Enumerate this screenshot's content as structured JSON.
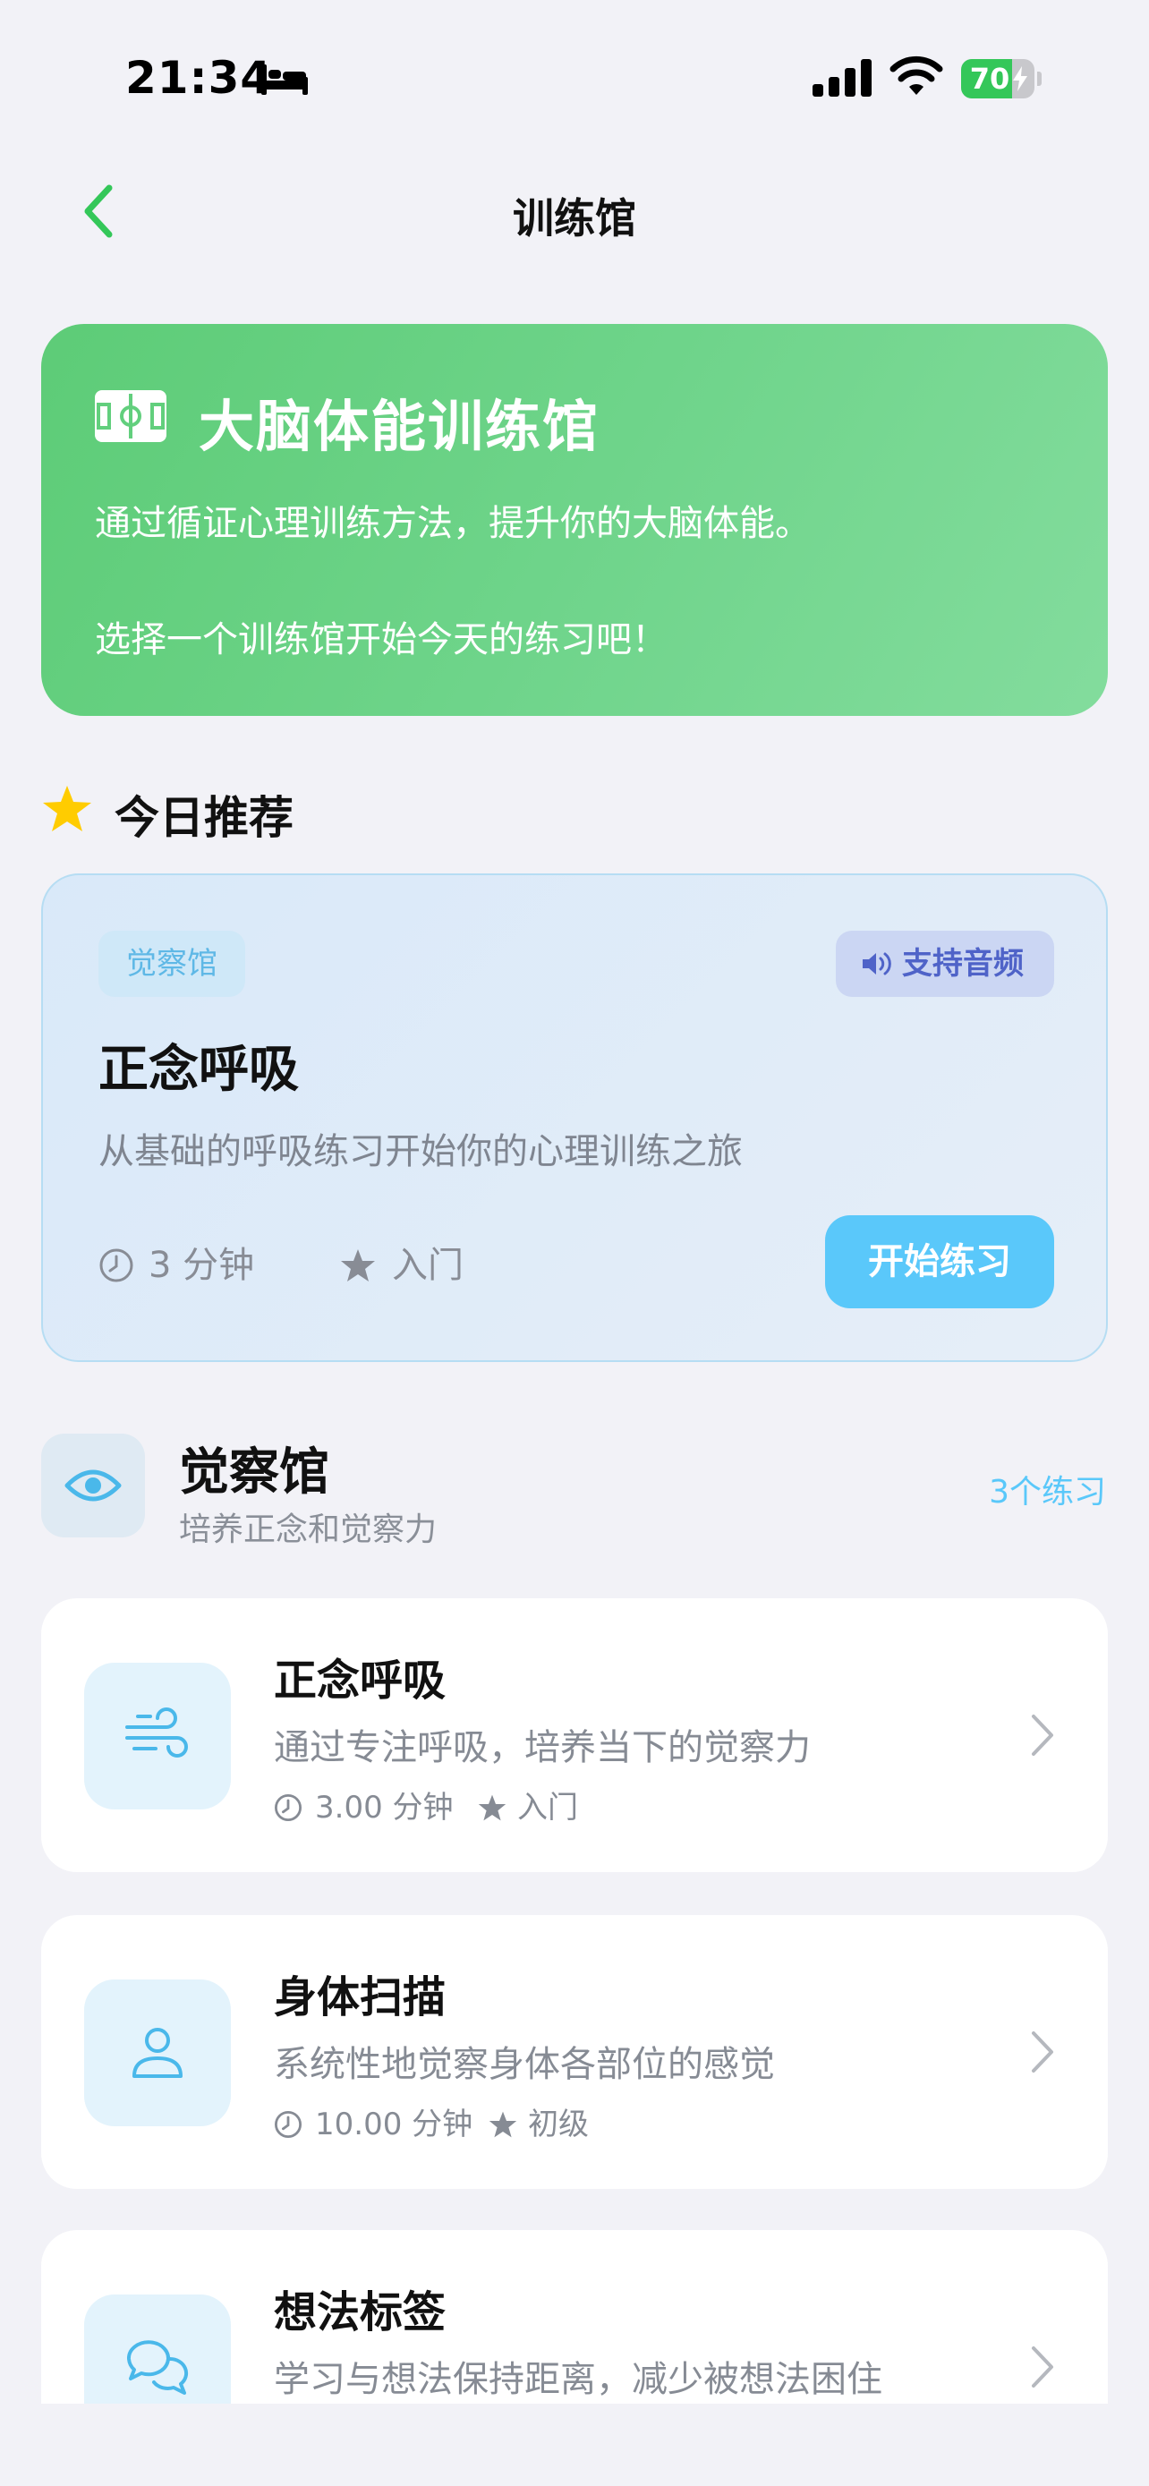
{
  "status_bar": {
    "time": "21:34",
    "battery": "70",
    "battery_level": 0.7
  },
  "nav": {
    "title": "训练馆"
  },
  "hero": {
    "title": "大脑体能训练馆",
    "desc1": "通过循证心理训练方法，提升你的大脑体能。",
    "desc2": "选择一个训练馆开始今天的练习吧！"
  },
  "today": {
    "title": "今日推荐",
    "card": {
      "tag": "觉察馆",
      "audio": "支持音频",
      "title": "正念呼吸",
      "desc": "从基础的呼吸练习开始你的心理训练之旅",
      "duration": "3 分钟",
      "level": "入门",
      "button": "开始练习"
    }
  },
  "category": {
    "title": "觉察馆",
    "subtitle": "培养正念和觉察力",
    "count": "3个练习",
    "items": [
      {
        "title": "正念呼吸",
        "desc": "通过专注呼吸，培养当下的觉察力",
        "duration": "3.00 分钟",
        "level": "入门",
        "icon": "wind-icon"
      },
      {
        "title": "身体扫描",
        "desc": "系统性地觉察身体各部位的感觉",
        "duration": "10.00 分钟",
        "level": "初级",
        "icon": "person-icon"
      },
      {
        "title": "想法标签",
        "desc": "学习与想法保持距离，减少被想法困住",
        "duration": "",
        "level": "",
        "icon": "chat-bubbles-icon"
      }
    ]
  },
  "colors": {
    "accent_green": "#5dcc77",
    "accent_blue": "#5ac8fa",
    "audio_text": "#4f63c8",
    "background": "#f2f2f7"
  }
}
